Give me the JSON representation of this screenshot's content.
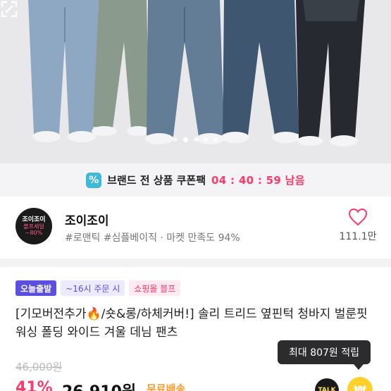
{
  "coupon": {
    "icon": "coupon-icon",
    "icon_glyph": "%",
    "text": "브랜드 전 상품 쿠폰팩",
    "timer": "04 : 40 : 59 남음"
  },
  "shop": {
    "logo": {
      "line1": "조이조이",
      "line2": "블프세일",
      "line3": "~80%"
    },
    "name": "조이조이",
    "meta": "#로맨틱 #심플베이직 · 마켓 만족도 94%",
    "likes": "111.1만"
  },
  "badges": {
    "today": "오늘출발",
    "time": "~16시 주문 시",
    "event": "쇼핑몰 블프"
  },
  "product": {
    "title": "[기모버전추가🔥/숏&롱/하체커버!] 솔리 트리드 옆핀턱 청바지 벌룬핏 워싱 폴딩 와이드 겨울 데님 팬츠",
    "original_price": "46,000원",
    "discount": "41%",
    "price": "26,910원",
    "shipping": "무료배송"
  },
  "tooltip": {
    "text": "최대 807원 적립"
  },
  "talk": {
    "label": "TALK"
  },
  "colors": {
    "accent_pink": "#ff3a6a",
    "badge_purple": "#5b4fe0",
    "shipping_orange": "#ff9a2a",
    "denim_light": "#8ea7c2",
    "denim_green": "#8a9a8c",
    "denim_mid": "#5e7893",
    "denim_dark": "#3f5670",
    "denim_black": "#24282e"
  },
  "icons": {
    "expand": "expand-icon",
    "heart": "heart-icon",
    "points": "points-coin-icon"
  }
}
